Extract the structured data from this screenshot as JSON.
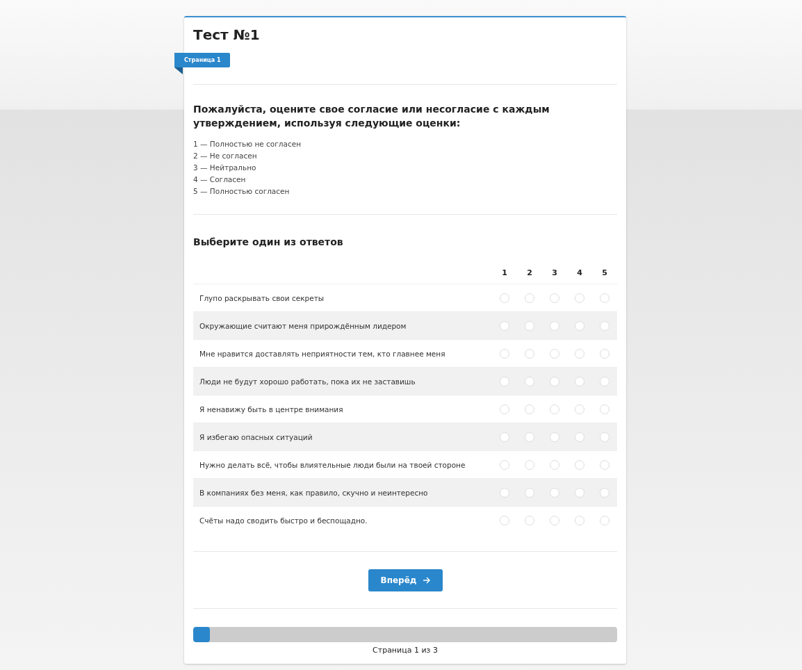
{
  "title": "Тест №1",
  "page_tag": "Страница 1",
  "instruction": "Пожалуйста, оцените свое согласие или несогласие с каждым утверждением, используя следующие оценки:",
  "scale": [
    "1 — Полностью не согласен",
    "2 — Не согласен",
    "3 — Нейтрально",
    "4 — Согласен",
    "5 — Полностью согласен"
  ],
  "question": "Выберите один из ответов",
  "columns": [
    "1",
    "2",
    "3",
    "4",
    "5"
  ],
  "rows": [
    {
      "text": "Глупо раскрывать свои секреты",
      "choices": [
        {
          "selected": false
        },
        {
          "selected": false
        },
        {
          "selected": false
        },
        {
          "selected": false
        },
        {
          "selected": false
        }
      ]
    },
    {
      "text": "Окружающие считают меня прирождённым лидером",
      "choices": [
        {
          "selected": false
        },
        {
          "selected": false
        },
        {
          "selected": false
        },
        {
          "selected": false
        },
        {
          "selected": false
        }
      ]
    },
    {
      "text": "Мне нравится доставлять неприятности тем, кто главнее меня",
      "choices": [
        {
          "selected": false
        },
        {
          "selected": false
        },
        {
          "selected": false
        },
        {
          "selected": false
        },
        {
          "selected": false
        }
      ]
    },
    {
      "text": "Люди не будут хорошо работать, пока их не заставишь",
      "choices": [
        {
          "selected": false
        },
        {
          "selected": false
        },
        {
          "selected": false
        },
        {
          "selected": false
        },
        {
          "selected": false
        }
      ]
    },
    {
      "text": "Я ненавижу быть в центре внимания",
      "choices": [
        {
          "selected": false
        },
        {
          "selected": false
        },
        {
          "selected": false
        },
        {
          "selected": false
        },
        {
          "selected": false
        }
      ]
    },
    {
      "text": "Я избегаю опасных ситуаций",
      "choices": [
        {
          "selected": false
        },
        {
          "selected": false
        },
        {
          "selected": false
        },
        {
          "selected": false
        },
        {
          "selected": false
        }
      ]
    },
    {
      "text": "Нужно делать всё, чтобы влиятельные люди были на твоей стороне",
      "choices": [
        {
          "selected": false
        },
        {
          "selected": false
        },
        {
          "selected": false
        },
        {
          "selected": false
        },
        {
          "selected": false
        }
      ]
    },
    {
      "text": "В компаниях без меня, как правило, скучно и неинтересно",
      "choices": [
        {
          "selected": false
        },
        {
          "selected": false
        },
        {
          "selected": false
        },
        {
          "selected": false
        },
        {
          "selected": false
        }
      ]
    },
    {
      "text": "Счёты надо сводить быстро и беспощадно.",
      "choices": [
        {
          "selected": false
        },
        {
          "selected": false
        },
        {
          "selected": false
        },
        {
          "selected": false
        },
        {
          "selected": false
        }
      ]
    }
  ],
  "next_button": "Вперёд",
  "progress": {
    "level": 0.04,
    "label": "Страница 1 из 3"
  }
}
